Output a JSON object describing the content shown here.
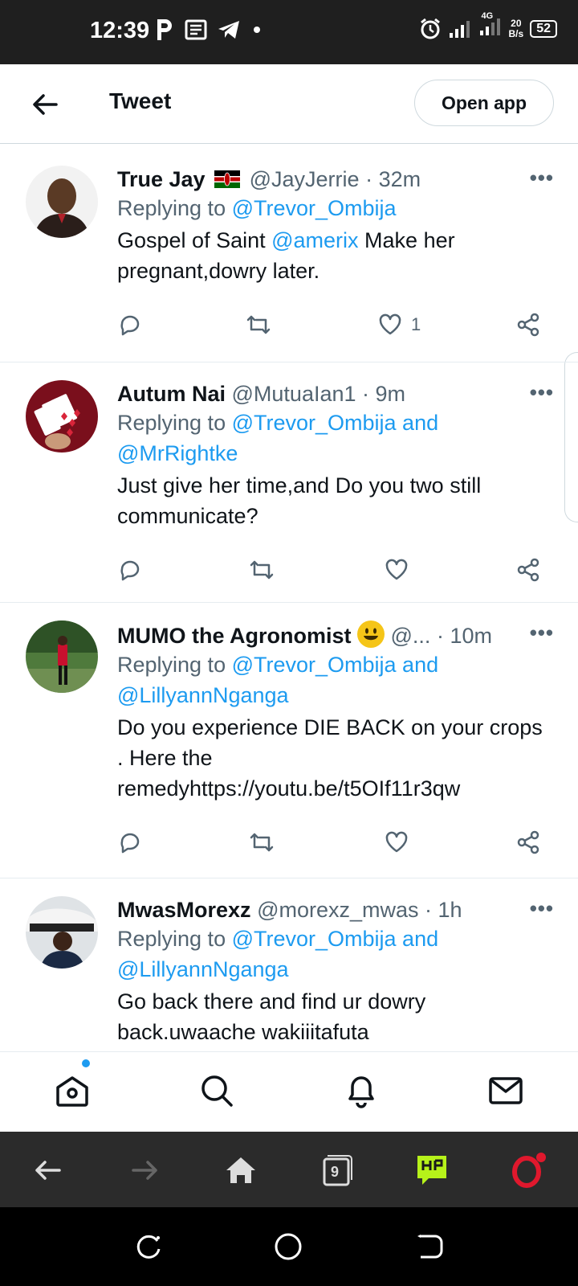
{
  "status_bar": {
    "time": "12:39",
    "network": "4G",
    "speed_value": "20",
    "speed_unit": "B/s",
    "battery": "52"
  },
  "header": {
    "title": "Tweet",
    "open_app_label": "Open app"
  },
  "tweets": [
    {
      "name": "True Jay",
      "handle": "@JayJerrie",
      "time": "· 32m",
      "replying_prefix": "Replying to ",
      "replying_to": "@Trevor_Ombija",
      "text_before": "Gospel of Saint ",
      "text_mention": "@amerix",
      "text_after": "  Make her pregnant,dowry later.",
      "likes": "1"
    },
    {
      "name": "Autum Nai",
      "handle": "@MutuaIan1",
      "time": "· 9m",
      "replying_prefix": "Replying to ",
      "replying_to": "@Trevor_Ombija and",
      "replying_to_2": "@MrRightke",
      "text": "Just give her time,and Do you two still communicate?"
    },
    {
      "name": "MUMO the Agronomist",
      "handle": "@...",
      "time": "· 10m",
      "replying_prefix": "Replying to ",
      "replying_to": "@Trevor_Ombija and",
      "replying_to_2": "@LillyannNganga",
      "text": "Do you experience DIE BACK on your crops . Here the remedyhttps://youtu.be/t5OIf11r3qw"
    },
    {
      "name": "MwasMorexz",
      "handle": "@morexz_mwas",
      "time": "· 1h",
      "replying_prefix": "Replying to ",
      "replying_to": "@Trevor_Ombija and",
      "replying_to_2": "@LillyannNganga",
      "text": "Go back there and find ur dowry back.uwaache wakiiitafuta"
    }
  ],
  "browser_bar": {
    "tabs_count": "9"
  },
  "colors": {
    "accent": "#1d9bf0",
    "muted": "#536471",
    "text": "#0f1419",
    "status_bar": "#1f1f1f",
    "browser_bar": "#2b2b2b",
    "opera_red": "#e0182d"
  },
  "icons": [
    "back-arrow-icon",
    "more-icon",
    "reply-icon",
    "retweet-icon",
    "like-icon",
    "share-icon",
    "home-icon",
    "search-icon",
    "bell-icon",
    "mail-icon",
    "browser-home-icon",
    "tabs-icon",
    "opera-icon"
  ]
}
